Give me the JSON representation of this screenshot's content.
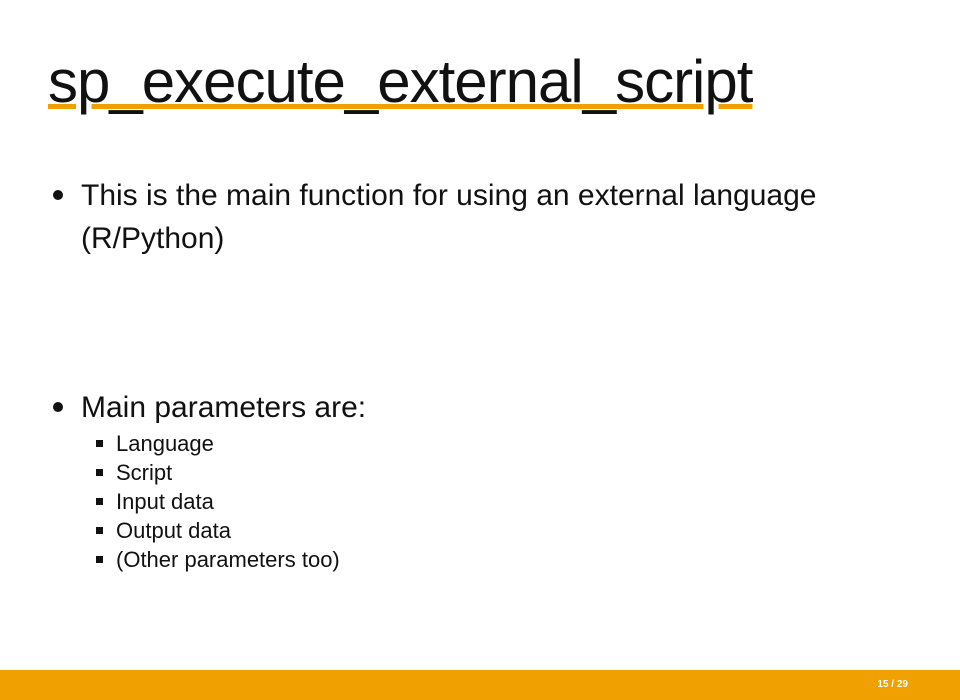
{
  "slide": {
    "title": "sp_execute_external_script",
    "bullets": [
      {
        "text": "This is the main function for using an external language (R/Python)"
      },
      {
        "text": "Main parameters are:",
        "sub_items": [
          "Language",
          "Script",
          "Input data",
          "Output data",
          "(Other parameters too)"
        ]
      }
    ]
  },
  "footer": {
    "page_indicator": "15 / 29"
  },
  "colors": {
    "accent": "#f0a000",
    "text": "#111111",
    "background": "#ffffff"
  }
}
